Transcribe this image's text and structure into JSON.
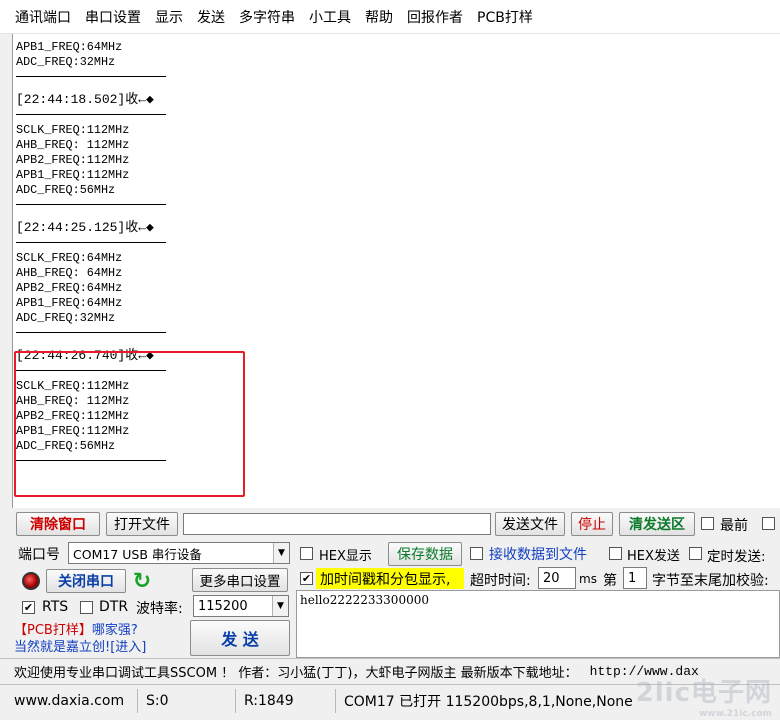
{
  "menu": [
    "通讯端口",
    "串口设置",
    "显示",
    "发送",
    "多字符串",
    "小工具",
    "帮助",
    "回报作者",
    "PCB打样"
  ],
  "receive": {
    "top_lines": [
      "APB1_FREQ:64MHz",
      "ADC_FREQ:32MHz"
    ],
    "blocks": [
      {
        "stamp": "[22:44:18.502]收←◆",
        "lines": [
          "SCLK_FREQ:112MHz",
          "AHB_FREQ: 112MHz",
          "APB2_FREQ:112MHz",
          "APB1_FREQ:112MHz",
          "ADC_FREQ:56MHz"
        ]
      },
      {
        "stamp": "[22:44:25.125]收←◆",
        "lines": [
          "SCLK_FREQ:64MHz",
          "AHB_FREQ: 64MHz",
          "APB2_FREQ:64MHz",
          "APB1_FREQ:64MHz",
          "ADC_FREQ:32MHz"
        ]
      },
      {
        "stamp": "[22:44:26.740]收←◆",
        "lines": [
          "SCLK_FREQ:112MHz",
          "AHB_FREQ: 112MHz",
          "APB2_FREQ:112MHz",
          "APB1_FREQ:112MHz",
          "ADC_FREQ:56MHz"
        ]
      }
    ]
  },
  "controls": {
    "clear_window": "清除窗口",
    "open_file": "打开文件",
    "file_path": "",
    "send_file": "发送文件",
    "stop": "停止",
    "clear_send": "清发送区",
    "latest_label": "最前",
    "port_label": "端口号",
    "port_value": "COM17 USB 串行设备",
    "hex_display": "HEX显示",
    "save_data": "保存数据",
    "recv_to_file": "接收数据到文件",
    "hex_send": "HEX发送",
    "timed_send": "定时发送:",
    "close_port": "关闭串口",
    "more_settings": "更多串口设置",
    "timestamp_label": "加时间戳和分包显示,",
    "timeout_label": "超时时间:",
    "timeout_value": "20",
    "timeout_unit": "ms",
    "nth_label": "第",
    "nth_value": "1",
    "byte_label": "字节至末尾加校验:",
    "rts": "RTS",
    "dtr": "DTR",
    "baud_label": "波特率:",
    "baud_value": "115200",
    "send_text": "hello2222233300000",
    "promo1_a": "【PCB打样】",
    "promo1_b": "哪家强?",
    "promo2_a": "当然就是嘉立创!",
    "promo2_b": "[进入]",
    "send_button": "发 送"
  },
  "ticker": {
    "text": "欢迎使用专业串口调试工具SSCOM ！  作者：习小猛(丁丁)，大虾电子网版主  最新版本下载地址：",
    "url": "http://www.dax"
  },
  "status": {
    "site": "www.daxia.com",
    "sent": "S:0",
    "received": "R:1849",
    "port_state": "COM17 已打开  115200bps,8,1,None,None"
  },
  "watermark": {
    "main": "2lic电子网",
    "sub": "www.21ic.com"
  },
  "colors": {
    "highlight": "#e81c24",
    "timestamp_bg": "#ffff00"
  }
}
